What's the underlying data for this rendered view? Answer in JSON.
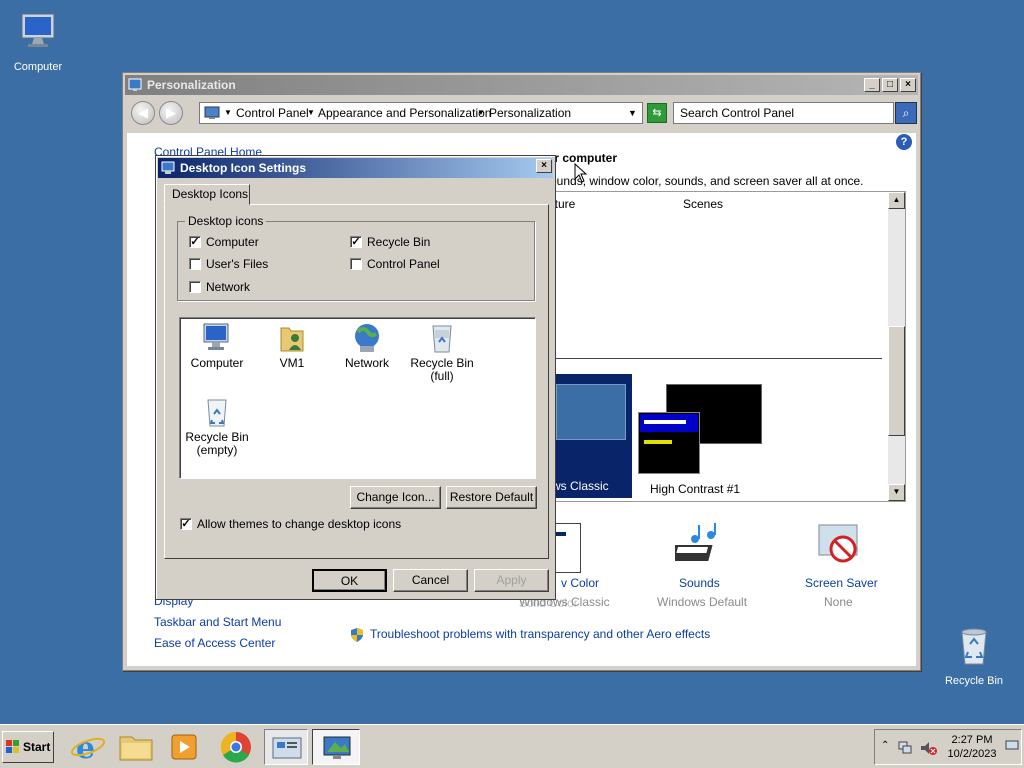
{
  "desktop": {
    "computer_label": "Computer",
    "recycle_label": "Recycle Bin"
  },
  "window": {
    "title": "Personalization",
    "breadcrumb": [
      "Control Panel",
      "Appearance and Personalization",
      "Personalization"
    ],
    "search_placeholder": "Search Control Panel",
    "sidebar": {
      "home": "Control Panel Home",
      "display": "Display",
      "taskbar": "Taskbar and Start Menu",
      "ease": "Ease of Access Center"
    },
    "heading_fragment": "ur computer",
    "sub_fragment": "ounds, window color, sounds, and screen saver all at once.",
    "theme_cols": [
      "ature",
      "Scenes"
    ],
    "themes": {
      "classic": "ws Classic",
      "hc": "High Contrast #1"
    },
    "bottom": {
      "wincolor": "v Color",
      "wincolor_sub": "Windows Classic",
      "solid_sub": "Solid Color",
      "sounds": "Sounds",
      "sounds_sub": "Windows Default",
      "saver": "Screen Saver",
      "saver_sub": "None"
    },
    "trouble": "Troubleshoot problems with transparency and other Aero effects"
  },
  "dialog": {
    "title": "Desktop Icon Settings",
    "tab": "Desktop Icons",
    "group_label": "Desktop icons",
    "checkboxes": [
      {
        "label": "Computer",
        "checked": true
      },
      {
        "label": "Recycle Bin",
        "checked": true
      },
      {
        "label": "User's Files",
        "checked": false
      },
      {
        "label": "Control Panel",
        "checked": false
      },
      {
        "label": "Network",
        "checked": false
      }
    ],
    "icons": [
      {
        "line1": "Computer",
        "line2": ""
      },
      {
        "line1": "VM1",
        "line2": ""
      },
      {
        "line1": "Network",
        "line2": ""
      },
      {
        "line1": "Recycle Bin",
        "line2": "(full)"
      },
      {
        "line1": "Recycle Bin",
        "line2": "(empty)"
      }
    ],
    "change_icon": "Change Icon...",
    "restore_default": "Restore Default",
    "allow_themes": "Allow themes to change desktop icons",
    "ok": "OK",
    "cancel": "Cancel",
    "apply": "Apply"
  },
  "taskbar": {
    "start": "Start",
    "time": "2:27 PM",
    "date": "10/2/2023"
  },
  "colors": {
    "desktop": "#3a6ea5",
    "dialog_title": "#0a246a",
    "link": "#0a3ca8"
  }
}
